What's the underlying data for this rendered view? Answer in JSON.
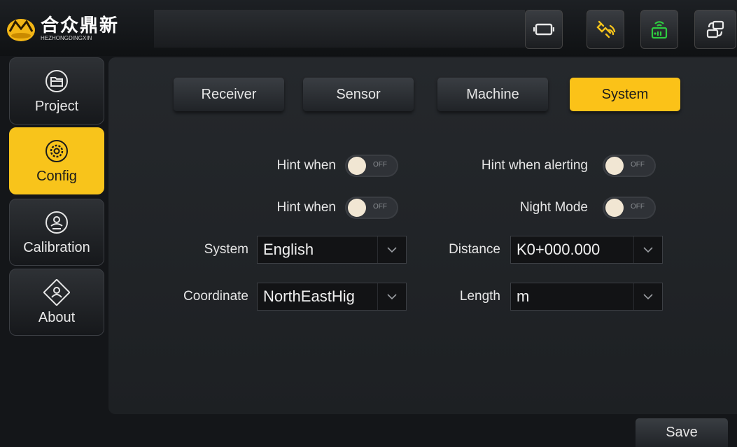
{
  "brand": {
    "name_cn": "合众鼎新",
    "name_en": "HEZHONGDINGXIN"
  },
  "topbar": {
    "icons": [
      "screen-frame-icon",
      "satellite-icon",
      "radio-signal-icon",
      "device-switch-icon"
    ],
    "colors": {
      "screen": "#e9e9e9",
      "satellite": "#f3c21b",
      "radio": "#2ecc40",
      "switch": "#e9e9e9"
    }
  },
  "sidebar": {
    "items": [
      {
        "label": "Project",
        "icon": "folder-icon"
      },
      {
        "label": "Config",
        "icon": "settings-gear-icon"
      },
      {
        "label": "Calibration",
        "icon": "calibration-icon"
      },
      {
        "label": "About",
        "icon": "about-icon"
      }
    ],
    "active": "Config"
  },
  "tabs": [
    {
      "label": "Receiver"
    },
    {
      "label": "Sensor"
    },
    {
      "label": "Machine"
    },
    {
      "label": "System"
    }
  ],
  "settings": {
    "hint_when_1": {
      "label": "Hint when",
      "state": "OFF"
    },
    "hint_when_alerting": {
      "label": "Hint when alerting",
      "state": "OFF"
    },
    "hint_when_2": {
      "label": "Hint when",
      "state": "OFF"
    },
    "night_mode": {
      "label": "Night Mode",
      "state": "OFF"
    },
    "system": {
      "label": "System",
      "value": "English"
    },
    "distance": {
      "label": "Distance",
      "value": "K0+000.000"
    },
    "coordinate": {
      "label": "Coordinate",
      "value": "NorthEastHig"
    },
    "length": {
      "label": "Length",
      "value": "m"
    }
  },
  "footer": {
    "save_label": "Save"
  },
  "colors": {
    "accent": "#f8c41b",
    "background": "#141619"
  }
}
